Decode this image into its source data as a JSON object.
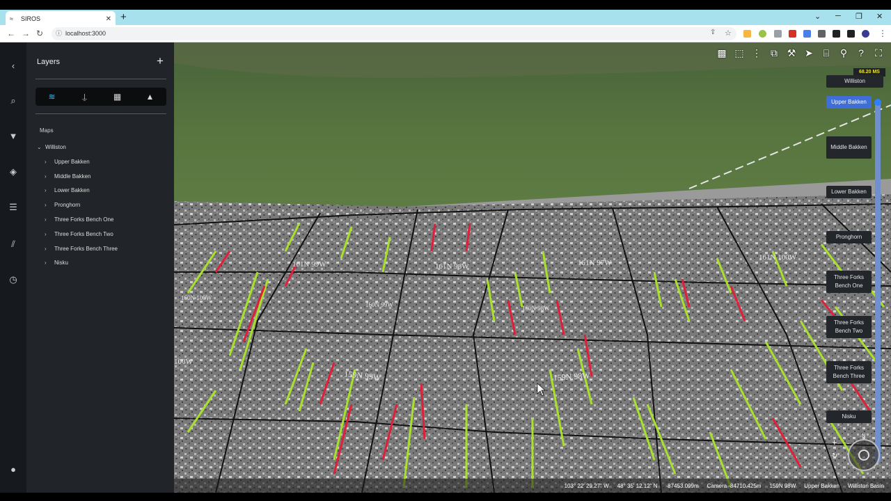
{
  "browser": {
    "tab_title": "SIROS",
    "tab_close": "✕",
    "new_tab": "+",
    "url": "localhost:3000"
  },
  "sidebar": {
    "title": "Layers",
    "add_label": "+",
    "segments": [
      {
        "icon": "layers-stack-icon",
        "glyph": "≋"
      },
      {
        "icon": "well-derrick-icon",
        "glyph": "⍊"
      },
      {
        "icon": "grid-icon",
        "glyph": "▦"
      },
      {
        "icon": "mountain-icon",
        "glyph": "▲"
      }
    ],
    "maps_label": "Maps",
    "root": "Williston",
    "items": [
      {
        "label": "Upper Bakken"
      },
      {
        "label": "Middle Bakken"
      },
      {
        "label": "Lower Bakken"
      },
      {
        "label": "Pronghorn"
      },
      {
        "label": "Three Forks Bench One"
      },
      {
        "label": "Three Forks Bench Two"
      },
      {
        "label": "Three Forks Bench Three"
      },
      {
        "label": "Nisku"
      }
    ]
  },
  "rail_icons": [
    "chevron-left-icon",
    "search-icon",
    "filter-icon",
    "layers-icon",
    "list-icon",
    "chart-icon",
    "history-icon",
    "user-icon"
  ],
  "map": {
    "frame_time": "68.20 MS",
    "layer_selector": {
      "top_label": "Williston",
      "levels": [
        {
          "label": "Upper Bakken",
          "active": true
        },
        {
          "label": "Middle Bakken",
          "active": false
        },
        {
          "label": "Lower Bakken",
          "active": false
        },
        {
          "label": "Pronghorn",
          "active": false
        },
        {
          "label": "Three Forks Bench One",
          "active": false
        },
        {
          "label": "Three Forks Bench Two",
          "active": false
        },
        {
          "label": "Three Forks Bench Three",
          "active": false
        },
        {
          "label": "Nisku",
          "active": false
        }
      ]
    },
    "grid_labels": [
      "159N 99W",
      "159N 98W",
      "160N 99W",
      "160N 98W",
      "161N 99W",
      "161N 98W",
      "161N 97W",
      "161N 100W",
      "160N 100W",
      "100W"
    ],
    "compass_north": "N",
    "zoom_in": "+",
    "reset": "↻",
    "status": {
      "longitude": "103° 22' 29.27\" W",
      "latitude": "48° 35' 12.12\" N",
      "elevation": "-87453.099m",
      "camera": "Camera -84710.425m",
      "township": "159N 98W",
      "formation": "Upper Bakken",
      "basin": "Williston Basin"
    }
  },
  "colors": {
    "accent": "#3f6fd6",
    "panel_bg": "#212529",
    "rail_bg": "#16191d",
    "producing_well": "#a8e02b",
    "permit_well": "#e0203a"
  }
}
